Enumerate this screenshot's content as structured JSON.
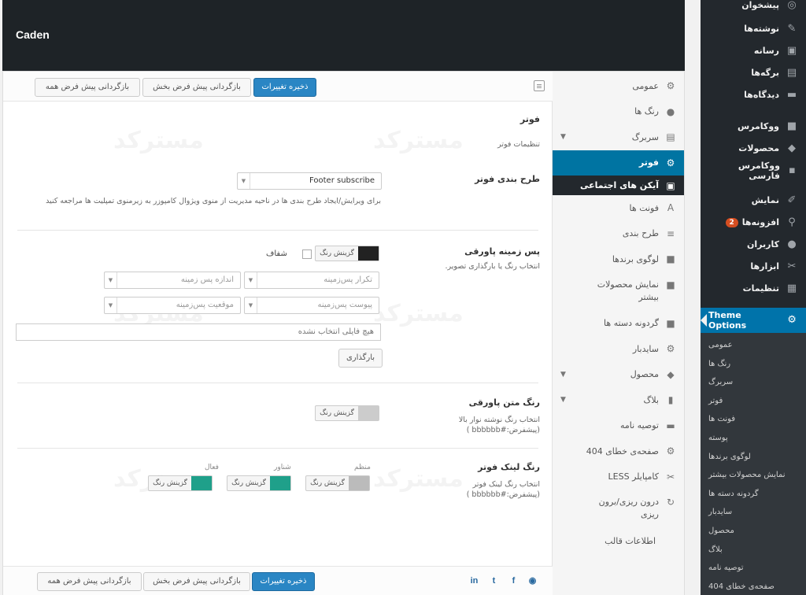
{
  "site": {
    "title": "Caden"
  },
  "wp_menu": {
    "items": [
      {
        "label": "پیشخوان",
        "icon": "dashboard-icon",
        "glyph": "◎"
      },
      {
        "label": "نوشته‌ها",
        "icon": "pin-icon",
        "glyph": "✎"
      },
      {
        "label": "رسانه",
        "icon": "media-icon",
        "glyph": "▣"
      },
      {
        "label": "برگه‌ها",
        "icon": "pages-icon",
        "glyph": "▤"
      },
      {
        "label": "دیدگاه‌ها",
        "icon": "comments-icon",
        "glyph": "▬"
      },
      {
        "label": "ووکامرس",
        "icon": "woocommerce-icon",
        "glyph": "■"
      },
      {
        "label": "محصولات",
        "icon": "products-icon",
        "glyph": "◆"
      },
      {
        "label": "ووکامرس فارسی",
        "icon": "woo-persian-icon",
        "glyph": "▪"
      },
      {
        "label": "نمایش",
        "icon": "appearance-icon",
        "glyph": "✐"
      },
      {
        "label": "افزونه‌ها",
        "icon": "plugins-icon",
        "glyph": "⚲",
        "badge": "2"
      },
      {
        "label": "کاربران",
        "icon": "users-icon",
        "glyph": "●"
      },
      {
        "label": "ابزارها",
        "icon": "tools-icon",
        "glyph": "✂"
      },
      {
        "label": "تنظیمات",
        "icon": "settings-icon",
        "glyph": "▦"
      }
    ],
    "active": {
      "label": "Theme Options",
      "icon": "gear-icon",
      "glyph": "⚙"
    },
    "submenu": [
      "عمومی",
      "رنگ ها",
      "سربرگ",
      "فوتر",
      "فونت ها",
      "پوسته",
      "لوگوی برندها",
      "نمایش محصولات بیشتر",
      "گردونه دسته ها",
      "سایدبار",
      "محصول",
      "بلاگ",
      "توصیه نامه",
      "صفحه‌ی خطای 404"
    ]
  },
  "options_nav": [
    {
      "label": "عمومی",
      "icon": "gear-icon",
      "glyph": "⚙"
    },
    {
      "label": "رنگ ها",
      "icon": "drop-icon",
      "glyph": "●"
    },
    {
      "label": "سربرگ",
      "icon": "header-icon",
      "glyph": "▤",
      "chevron": "▼"
    },
    {
      "label": "فوتر",
      "icon": "gear-icon",
      "glyph": "⚙",
      "active": true
    },
    {
      "label": "آیکن های اجتماعی",
      "icon": "social-icons-icon",
      "glyph": "▣",
      "subactive": true
    },
    {
      "label": "فونت ها",
      "icon": "font-icon",
      "glyph": "A"
    },
    {
      "label": "طرح بندی",
      "icon": "layout-icon",
      "glyph": "≡"
    },
    {
      "label": "لوگوی برندها",
      "icon": "briefcase-icon",
      "glyph": "■"
    },
    {
      "label": "نمایش محصولات بیشتر",
      "icon": "briefcase-icon",
      "glyph": "■",
      "tall": true
    },
    {
      "label": "گردونه دسته ها",
      "icon": "briefcase-icon",
      "glyph": "■"
    },
    {
      "label": "سایدبار",
      "icon": "gear-icon",
      "glyph": "⚙"
    },
    {
      "label": "محصول",
      "icon": "tag-icon",
      "glyph": "◆",
      "chevron": "▼"
    },
    {
      "label": "بلاگ",
      "icon": "blog-icon",
      "glyph": "▮",
      "chevron": "▼"
    },
    {
      "label": "توصیه نامه",
      "icon": "chat-icon",
      "glyph": "▬"
    },
    {
      "label": "صفحه‌ی خطای 404",
      "icon": "gear-icon",
      "glyph": "⚙"
    },
    {
      "label": "کامپایلر LESS",
      "icon": "wrench-icon",
      "glyph": "✂"
    },
    {
      "label": "درون ریزی/برون ریزی",
      "icon": "refresh-icon",
      "glyph": "↻",
      "tall": true
    },
    {
      "label": "اطلاعات قالب",
      "icon": "",
      "glyph": ""
    }
  ],
  "toolbar": {
    "save": "ذخیره تغییرات",
    "reset_section": "بازگردانی پیش فرض بخش",
    "reset_all": "بازگردانی پیش فرض همه"
  },
  "section": {
    "title": "فوتر",
    "subtitle": "تنظیمات فوتر"
  },
  "footer_layout": {
    "title": "طرح بندی فوتر",
    "selected": "Footer subscribe",
    "help": "برای ویرایش/ایجاد طرح بندی ها در ناحیه مدیریت از منوی ویژوال کامپوزر به زیرمنوی تمپلیت ها مراجعه کنید"
  },
  "footer_bg": {
    "title": "پس زمینه پاورقی",
    "desc": "انتخاب رنگ یا بارگذاری تصویر.",
    "picker_label": "گزینش رنگ",
    "swatch": "#222222",
    "transparent_label": "شفاف",
    "repeat_placeholder": "تکرار پس‌زمینه",
    "size_placeholder": "اندازه پس زمینه",
    "attachment_placeholder": "پیوست پس‌زمینه",
    "position_placeholder": "موقعیت پس‌زمینه",
    "media_placeholder": "هیچ فایلی انتخاب نشده",
    "upload_label": "بارگذاری"
  },
  "footer_text_color": {
    "title": "رنگ متن پاورقی",
    "desc": "انتخاب رنگ نوشته نوار بالا",
    "default": "(پیشفرض:#bbbbbb )",
    "picker_label": "گزینش رنگ",
    "swatch": "#cccccc"
  },
  "footer_link_color": {
    "title": "رنگ لینک فوتر",
    "desc": "انتخاب رنگ لینک فوتر",
    "default": "(پیشفرض:#bbbbbb )",
    "regular_label": "منظم",
    "hover_label": "شناور",
    "active_label": "فعال",
    "picker_label": "گزینش رنگ",
    "regular_swatch": "#bbbbbb",
    "hover_swatch": "#1fa08a",
    "active_swatch": "#1fa08a"
  },
  "social_icons": [
    {
      "name": "linkedin-icon",
      "glyph": "in"
    },
    {
      "name": "twitter-icon",
      "glyph": "t"
    },
    {
      "name": "facebook-icon",
      "glyph": "f"
    },
    {
      "name": "wordpress-icon",
      "glyph": "◉"
    }
  ],
  "watermark": "مسترکد"
}
